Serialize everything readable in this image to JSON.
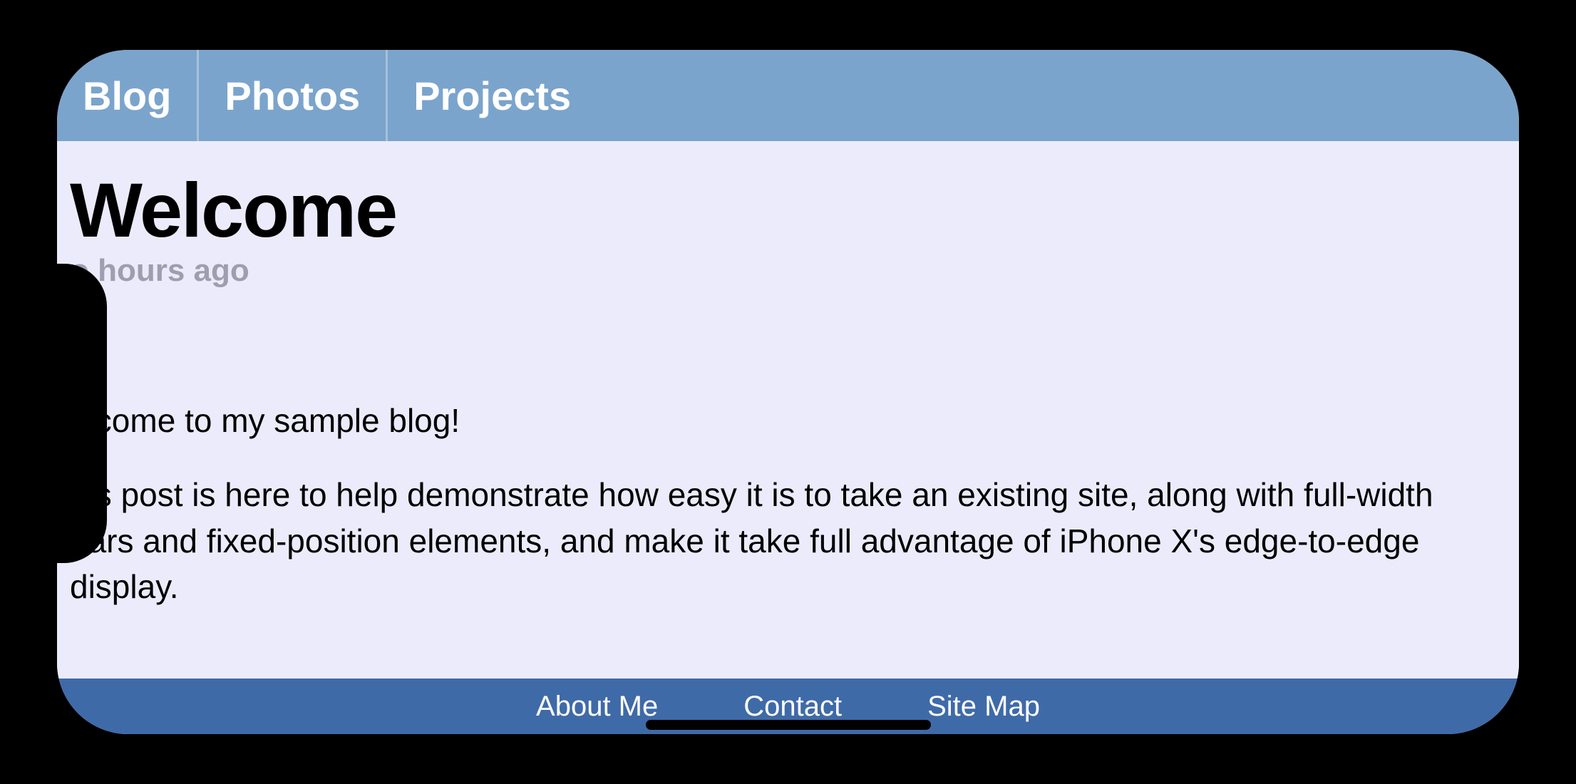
{
  "tabs": [
    {
      "label": "Blog"
    },
    {
      "label": "Photos"
    },
    {
      "label": "Projects"
    }
  ],
  "post": {
    "title": "Welcome",
    "meta_partial": "o hours ago",
    "body": {
      "p1_partial": "!",
      "p2_partial": "elcome to my sample blog!",
      "p3_partial": "his post is here to help demonstrate how easy it is to take an existing site, along with full-width bars and fixed-position elements, and make it take full advantage of iPhone X's edge-to-edge display."
    }
  },
  "footer": [
    {
      "label": "About Me"
    },
    {
      "label": "Contact"
    },
    {
      "label": "Site Map"
    }
  ]
}
